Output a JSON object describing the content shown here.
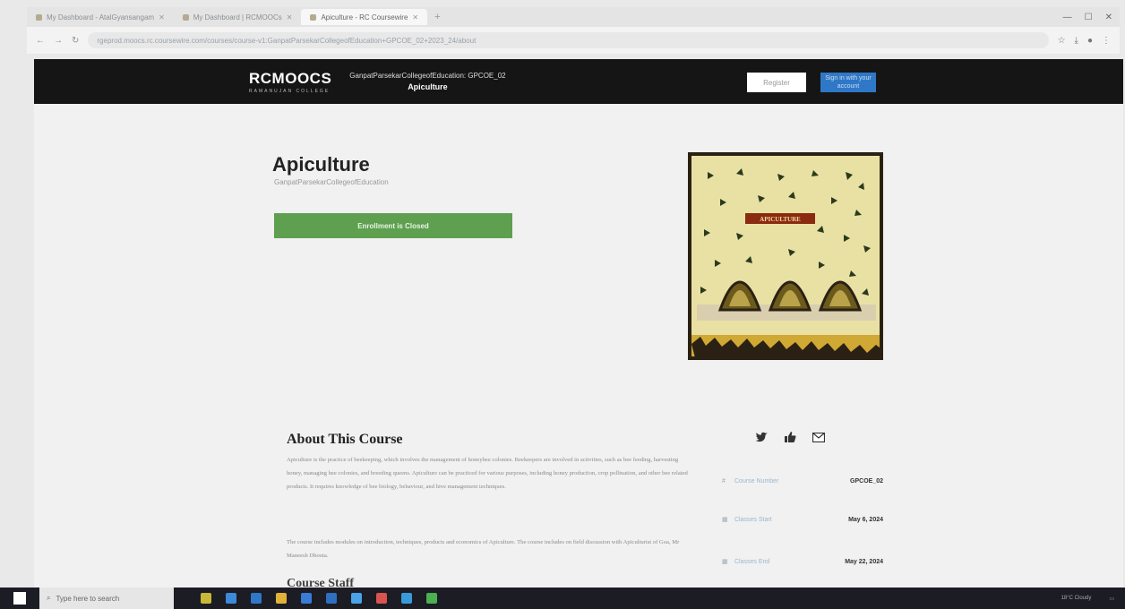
{
  "browser": {
    "tabs": [
      {
        "label": "My Dashboard - AtalGyansangam",
        "active": false
      },
      {
        "label": "My Dashboard | RCMOOCs",
        "active": false
      },
      {
        "label": "Apiculture - RC Coursewire",
        "active": true
      }
    ],
    "url": "rgeprod.moocs.rc.coursewire.com/courses/course-v1:GanpatParsekarCollegeofEducation+GPCOE_02+2023_24/about"
  },
  "header": {
    "logo": "RCMOOCS",
    "logo_sub": "RAMANUJAN COLLEGE",
    "course_org": "GanpatParsekarCollegeofEducation: GPCOE_02",
    "course_name": "Apiculture",
    "register_label": "Register",
    "signin_label": "Sign in with your account"
  },
  "course": {
    "title": "Apiculture",
    "org": "GanpatParsekarCollegeofEducation",
    "enroll_label": "Enrollment is Closed",
    "image_label": "APICULTURE"
  },
  "about": {
    "title": "About This Course",
    "p1": "Apiculture is the practice of beekeeping, which involves the management of honeybee colonies. Beekeepers are involved in activities, such as bee feeding, harvesting honey, managing bee colonies, and breeding queens. Apiculture can be practiced for various purposes, including honey production, crop pollination, and other bee related products. It requires knowledge of bee biology, behaviour, and hive management techniques.",
    "p2": "The course includes modules on introduction, techniques, products and economics of Apiculture. The course includes on field discussion with Apiculturist of Goa, Mr Maneesh Dhouta.",
    "staff_title": "Course Staff"
  },
  "share": {
    "icons": [
      "twitter-icon",
      "facebook-like-icon",
      "email-icon"
    ]
  },
  "meta": [
    {
      "icon": "course-number-icon",
      "label": "Course Number",
      "value": "GPCOE_02"
    },
    {
      "icon": "calendar-icon",
      "label": "Classes Start",
      "value": "May 6, 2024"
    },
    {
      "icon": "calendar-icon",
      "label": "Classes End",
      "value": "May 22, 2024"
    }
  ],
  "taskbar": {
    "search_placeholder": "Type here to search",
    "tray_text": "18°C Cloudy"
  },
  "colors": {
    "header_bg": "#151515",
    "enroll_green": "#5ea04f",
    "signin_blue": "#2f78c7"
  }
}
